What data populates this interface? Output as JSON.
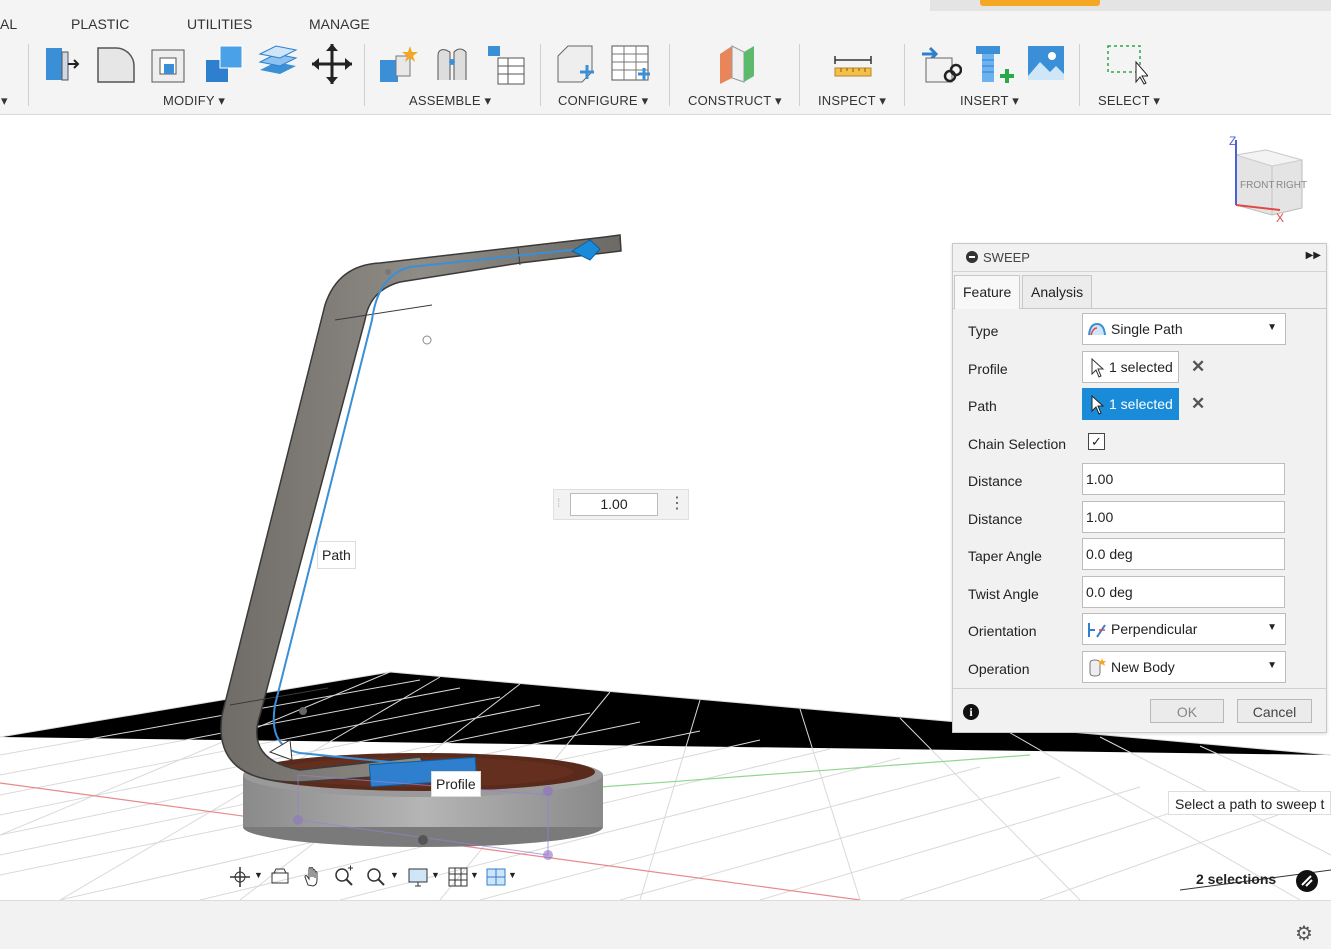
{
  "ribbon": {
    "tabs": [
      "AL",
      "PLASTIC",
      "UTILITIES",
      "MANAGE"
    ],
    "groups": {
      "modify": "MODIFY ▾",
      "assemble": "ASSEMBLE ▾",
      "configure": "CONFIGURE ▾",
      "construct": "CONSTRUCT ▾",
      "inspect": "INSPECT ▾",
      "insert": "INSERT ▾",
      "select": "SELECT ▾",
      "left_caret": "▾"
    }
  },
  "viewcube": {
    "top": "Z",
    "front": "FRONT",
    "right": "RIGHT",
    "x": "X"
  },
  "viewport": {
    "distance_input": "1.00",
    "path_label": "Path",
    "profile_label": "Profile",
    "hint": "Select a path to sweep t",
    "selection_count": "2 selections"
  },
  "sweep": {
    "title": "SWEEP",
    "tabs": {
      "feature": "Feature",
      "analysis": "Analysis"
    },
    "rows": {
      "type": {
        "label": "Type",
        "value": "Single Path"
      },
      "profile": {
        "label": "Profile",
        "value": "1 selected"
      },
      "path": {
        "label": "Path",
        "value": "1 selected"
      },
      "chain": {
        "label": "Chain Selection",
        "checked": "✓"
      },
      "distance1": {
        "label": "Distance",
        "value": "1.00"
      },
      "distance2": {
        "label": "Distance",
        "value": "1.00"
      },
      "taper": {
        "label": "Taper Angle",
        "value": "0.0 deg"
      },
      "twist": {
        "label": "Twist Angle",
        "value": "0.0 deg"
      },
      "orientation": {
        "label": "Orientation",
        "value": "Perpendicular"
      },
      "operation": {
        "label": "Operation",
        "value": "New Body"
      }
    },
    "buttons": {
      "ok": "OK",
      "cancel": "Cancel"
    }
  },
  "colors": {
    "accent": "#1a8bd9",
    "wood": "#5a2a1c",
    "shell": "#8f8c86"
  }
}
